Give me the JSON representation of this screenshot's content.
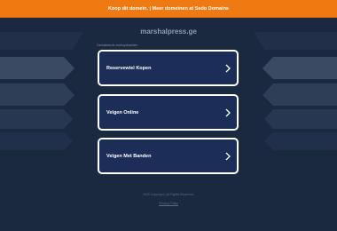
{
  "top_banner": {
    "text": "Koop dit domein. | Meer domeinen at Sedo Domains",
    "bg_color": "#f07a12"
  },
  "domain": {
    "name": "marshalpress.ge"
  },
  "related_label": "Gerelateerde zoekopdrachten",
  "links": [
    {
      "label": "Reservewiel Kopen",
      "icon": "chevron-right-icon"
    },
    {
      "label": "Velgen Online",
      "icon": "chevron-right-icon"
    },
    {
      "label": "Velgen Met Banden",
      "icon": "chevron-right-icon"
    }
  ],
  "footer": {
    "copyright": "2025 Copyright | All Rights Reserved.",
    "privacy_label": "Privacy Policy"
  },
  "colors": {
    "background": "#1a2840",
    "card_bg": "#1c2e57",
    "card_border": "#ffffff"
  }
}
